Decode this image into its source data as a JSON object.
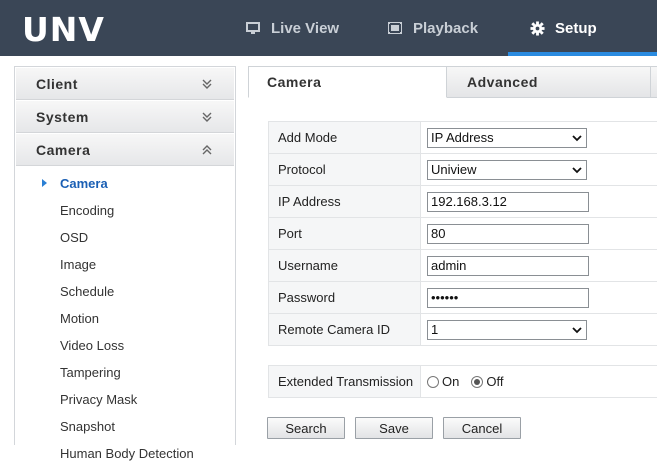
{
  "header": {
    "logo": "UNV",
    "nav": [
      {
        "label": "Live View",
        "icon": "monitor-icon"
      },
      {
        "label": "Playback",
        "icon": "film-icon"
      },
      {
        "label": "Setup",
        "icon": "gear-icon"
      }
    ],
    "active_nav": "Setup",
    "colors": {
      "bar": "#3a4656",
      "accent": "#2a8be0"
    }
  },
  "sidebar": {
    "groups": [
      {
        "label": "Client",
        "expanded": false
      },
      {
        "label": "System",
        "expanded": false
      },
      {
        "label": "Camera",
        "expanded": true
      }
    ],
    "items": [
      "Camera",
      "Encoding",
      "OSD",
      "Image",
      "Schedule",
      "Motion",
      "Video Loss",
      "Tampering",
      "Privacy Mask",
      "Snapshot",
      "Human Body Detection"
    ],
    "active_item": "Camera"
  },
  "tabs": [
    {
      "label": "Camera",
      "active": true
    },
    {
      "label": "Advanced",
      "active": false
    }
  ],
  "form": {
    "add_mode": {
      "label": "Add Mode",
      "value": "IP Address"
    },
    "protocol": {
      "label": "Protocol",
      "value": "Uniview"
    },
    "ip_address": {
      "label": "IP Address",
      "value": "192.168.3.12"
    },
    "port": {
      "label": "Port",
      "value": "80"
    },
    "username": {
      "label": "Username",
      "value": "admin"
    },
    "password": {
      "label": "Password",
      "value": "••••••"
    },
    "remote_camera_id": {
      "label": "Remote Camera ID",
      "value": "1"
    },
    "extended_transmission": {
      "label": "Extended Transmission",
      "options": [
        "On",
        "Off"
      ],
      "selected": "Off"
    }
  },
  "buttons": {
    "search": "Search",
    "save": "Save",
    "cancel": "Cancel"
  }
}
